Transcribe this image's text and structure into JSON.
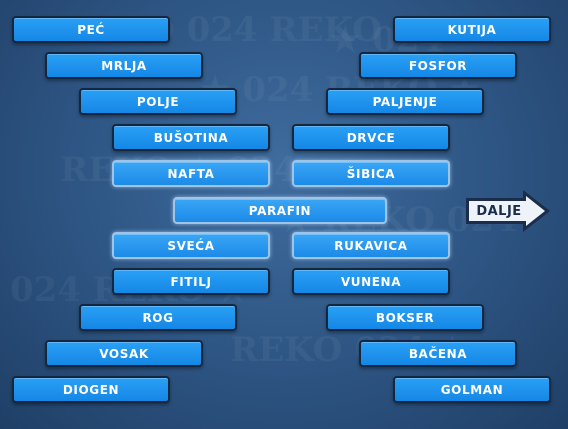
{
  "left_column": [
    "PEĆ",
    "MRLJA",
    "POLJE",
    "BUŠOTINA",
    "NAFTA",
    "SVEĆA",
    "FITILJ",
    "ROG",
    "VOSAK",
    "DIOGEN"
  ],
  "right_column": [
    "KUTIJA",
    "FOSFOR",
    "PALJENJE",
    "DRVCE",
    "ŠIBICA",
    "RUKAVICA",
    "VUNENA",
    "BOKSER",
    "BAČENA",
    "GOLMAN"
  ],
  "center": "PARAFIN",
  "next_button": "DALJE",
  "colors": {
    "tile": "#1e92ee",
    "tile_border": "#16263d",
    "solved_border": "#9fc4e6",
    "background": "#2d5482"
  }
}
